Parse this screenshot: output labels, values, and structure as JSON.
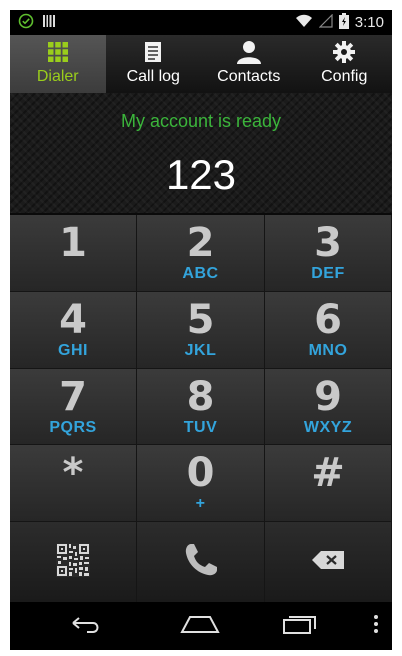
{
  "status_bar": {
    "time": "3:10",
    "icons": [
      "check-circle-icon",
      "barcode-icon",
      "wifi-icon",
      "signal-icon",
      "battery-icon"
    ]
  },
  "tabs": [
    {
      "label": "Dialer",
      "icon": "grid-icon",
      "active": true
    },
    {
      "label": "Call log",
      "icon": "list-icon",
      "active": false
    },
    {
      "label": "Contacts",
      "icon": "person-icon",
      "active": false
    },
    {
      "label": "Config",
      "icon": "gear-icon",
      "active": false
    }
  ],
  "display": {
    "status": "My account is ready",
    "number": "123"
  },
  "keypad": [
    {
      "digit": "1",
      "letters": ""
    },
    {
      "digit": "2",
      "letters": "ABC"
    },
    {
      "digit": "3",
      "letters": "DEF"
    },
    {
      "digit": "4",
      "letters": "GHI"
    },
    {
      "digit": "5",
      "letters": "JKL"
    },
    {
      "digit": "6",
      "letters": "MNO"
    },
    {
      "digit": "7",
      "letters": "PQRS"
    },
    {
      "digit": "8",
      "letters": "TUV"
    },
    {
      "digit": "9",
      "letters": "WXYZ"
    },
    {
      "digit": "*",
      "letters": ""
    },
    {
      "digit": "0",
      "letters": "+"
    },
    {
      "digit": "#",
      "letters": ""
    }
  ],
  "actions": [
    "qr-code-icon",
    "phone-icon",
    "backspace-icon"
  ],
  "navbar": [
    "back-icon",
    "home-icon",
    "recents-icon",
    "overflow-menu-icon"
  ],
  "colors": {
    "accent_green": "#9acd1c",
    "status_green": "#3bb53b",
    "letters_blue": "#33a4dc"
  }
}
